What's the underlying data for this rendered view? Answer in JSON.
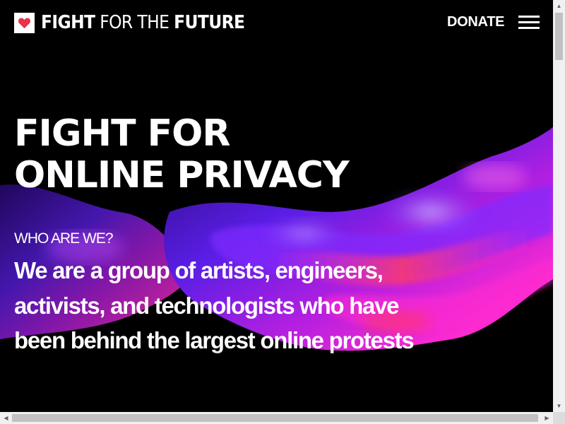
{
  "header": {
    "logo_bold_1": "FIGHT",
    "logo_light": " FOR THE ",
    "logo_bold_2": "FUTURE",
    "logo_icon": "heart-icon",
    "donate_label": "DONATE",
    "menu_icon": "hamburger-menu-icon"
  },
  "hero": {
    "title_line_1": "FIGHT FOR",
    "title_line_2": "ONLINE PRIVACY",
    "who_label": "WHO ARE WE?",
    "about_text": "We are a group of artists, engineers, activists, and technologists who have been behind the largest online protests"
  },
  "colors": {
    "background": "#000000",
    "text": "#ffffff",
    "heart": "#e8334a",
    "art_purple": "#5a1ee6",
    "art_magenta": "#ff2bd0",
    "art_red": "#ff3a3a"
  }
}
